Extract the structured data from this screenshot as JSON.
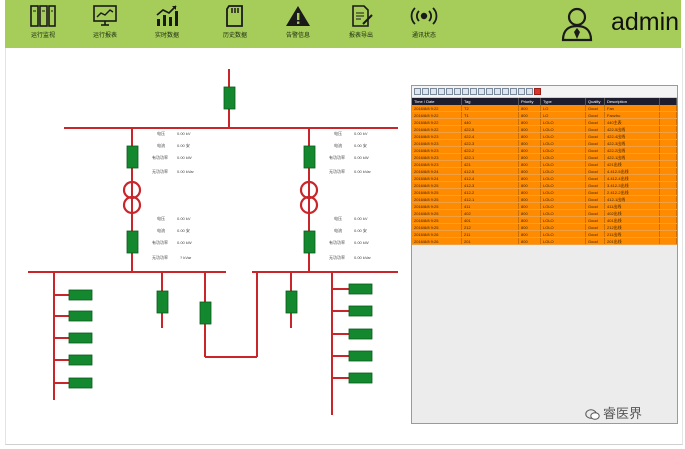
{
  "nav": {
    "items": [
      {
        "id": "realtime",
        "label": "运行监视",
        "icon": "cabinet-icon"
      },
      {
        "id": "operation",
        "label": "运行报表",
        "icon": "monitor-chart-icon"
      },
      {
        "id": "data",
        "label": "实时数据",
        "icon": "bar-trend-icon"
      },
      {
        "id": "history",
        "label": "历史数据",
        "icon": "sd-card-icon"
      },
      {
        "id": "alarm",
        "label": "告警信息",
        "icon": "warning-icon"
      },
      {
        "id": "report",
        "label": "报表导出",
        "icon": "document-edit-icon"
      },
      {
        "id": "comm",
        "label": "通讯状态",
        "icon": "broadcast-icon"
      }
    ]
  },
  "user": {
    "name": "admin",
    "icon": "user-avatar-icon"
  },
  "diagram": {
    "colors": {
      "bus": "#c8262b",
      "breaker": "#13882e",
      "breaker_border": "#0a5a1c",
      "transformer": "#c8262b"
    },
    "upper_left": {
      "rows": [
        {
          "label": "电压",
          "value": "0.00 kV"
        },
        {
          "label": "电流",
          "value": "0.00 安"
        },
        {
          "label": "有功功率",
          "value": "0.00 kW"
        },
        {
          "label": "无功功率",
          "value": "0.00 kVar"
        }
      ]
    },
    "upper_right": {
      "rows": [
        {
          "label": "电压",
          "value": "0.00 kV"
        },
        {
          "label": "电流",
          "value": "0.00 安"
        },
        {
          "label": "有功功率",
          "value": "0.00 kW"
        },
        {
          "label": "无功功率",
          "value": "0.00 kVar"
        }
      ]
    },
    "lower_left": {
      "rows": [
        {
          "label": "电压",
          "value": "0.00 kV"
        },
        {
          "label": "电流",
          "value": "0.00 安"
        },
        {
          "label": "有功功率",
          "value": "0.00 kW"
        },
        {
          "label": "无功功率",
          "value": "? kVar"
        }
      ]
    },
    "lower_right": {
      "rows": [
        {
          "label": "电压",
          "value": "0.00 kV"
        },
        {
          "label": "电流",
          "value": "0.00 安"
        },
        {
          "label": "有功功率",
          "value": "0.00 kW"
        },
        {
          "label": "无功功率",
          "value": "0.00 kVar"
        }
      ]
    }
  },
  "alarm_panel": {
    "toolbar_icons": [
      "filter-icon",
      "grid-icon",
      "home-icon",
      "table-icon",
      "sort-icon",
      "funnel-icon",
      "chart-icon",
      "checkmark-icon",
      "copy-icon",
      "paste-icon",
      "list-icon",
      "zoom-icon",
      "export-icon",
      "refresh-icon",
      "save-icon",
      "delete-icon"
    ],
    "columns": [
      "Time / Date",
      "Tag",
      "Priority",
      "Type",
      "Quality",
      "Description",
      ""
    ],
    "rows": [
      [
        "2016/8/8 9:22",
        "T2",
        "800",
        "LO",
        "Good",
        "Fan",
        ""
      ],
      [
        "2016/8/8 9:22",
        "T1",
        "800",
        "LO",
        "Good",
        "Fanzhu",
        ""
      ],
      [
        "2016/8/8 9:22",
        "440",
        "800",
        "LOLO",
        "Good",
        "440主表",
        ""
      ],
      [
        "2016/8/8 9:22",
        "422-5",
        "800",
        "LOLO",
        "Good",
        "422-5出线",
        ""
      ],
      [
        "2016/8/8 9:23",
        "422-4",
        "800",
        "LOLO",
        "Good",
        "422-4出线",
        ""
      ],
      [
        "2016/8/8 9:23",
        "422-3",
        "800",
        "LOLO",
        "Good",
        "422-3出线",
        ""
      ],
      [
        "2016/8/8 9:23",
        "422-2",
        "800",
        "LOLO",
        "Good",
        "422-2出线",
        ""
      ],
      [
        "2016/8/8 9:23",
        "422-1",
        "800",
        "LOLO",
        "Good",
        "422-1出线",
        ""
      ],
      [
        "2016/8/8 9:23",
        "421",
        "800",
        "LOLO",
        "Good",
        "421出线",
        ""
      ],
      [
        "2016/8/8 9:24",
        "412-5",
        "800",
        "LOLO",
        "Good",
        "4.412-5出线",
        ""
      ],
      [
        "2016/8/8 9:24",
        "412-4",
        "800",
        "LOLO",
        "Good",
        "4.412-4出线",
        ""
      ],
      [
        "2016/8/8 9:25",
        "412-3",
        "800",
        "LOLO",
        "Good",
        "3.412-3出线",
        ""
      ],
      [
        "2016/8/8 9:25",
        "412-2",
        "800",
        "LOLO",
        "Good",
        "2.412-2出线",
        ""
      ],
      [
        "2016/8/8 9:25",
        "412-1",
        "800",
        "LOLO",
        "Good",
        "412-1出线",
        ""
      ],
      [
        "2016/8/8 9:25",
        "411",
        "800",
        "LOLO",
        "Good",
        "411出线",
        ""
      ],
      [
        "2016/8/8 9:25",
        "402",
        "800",
        "LOLO",
        "Good",
        "402出线",
        ""
      ],
      [
        "2016/8/8 9:25",
        "401",
        "800",
        "LOLO",
        "Good",
        "401出线",
        ""
      ],
      [
        "2016/8/8 9:25",
        "212",
        "800",
        "LOLO",
        "Good",
        "212出线",
        ""
      ],
      [
        "2016/8/8 9:26",
        "211",
        "800",
        "LOLO",
        "Good",
        "211出线",
        ""
      ],
      [
        "2016/8/8 9:26",
        "201",
        "800",
        "LOLO",
        "Good",
        "201出线",
        ""
      ]
    ]
  },
  "watermark": {
    "text": "睿医界",
    "icon": "wechat-icon"
  }
}
